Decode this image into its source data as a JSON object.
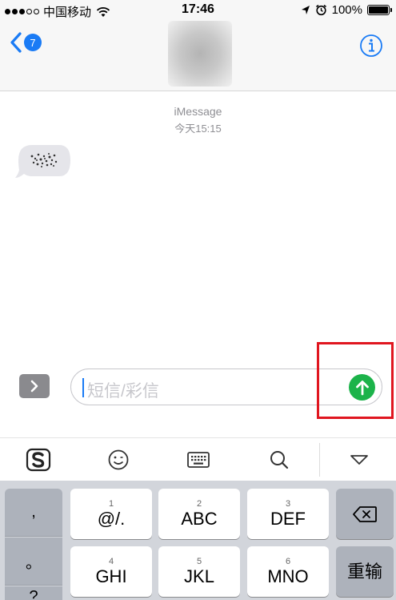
{
  "status_bar": {
    "carrier": "中国移动",
    "time": "17:46",
    "battery": "100%",
    "battery_level": 1.0
  },
  "nav": {
    "unread_count": "7"
  },
  "conversation": {
    "service": "iMessage",
    "timestamp": "今天15:15"
  },
  "composer": {
    "placeholder": "短信/彩信"
  },
  "toolbar": {
    "items": [
      "sogou-logo-icon",
      "emoji-icon",
      "keyboard-icon",
      "search-icon",
      "collapse-icon"
    ]
  },
  "keyboard": {
    "left_keys": [
      ",",
      "。",
      "?"
    ],
    "keys": [
      {
        "num": "1",
        "label": "@/."
      },
      {
        "num": "2",
        "label": "ABC"
      },
      {
        "num": "3",
        "label": "DEF"
      },
      {
        "num": "4",
        "label": "GHI"
      },
      {
        "num": "5",
        "label": "JKL"
      },
      {
        "num": "6",
        "label": "MNO"
      }
    ],
    "enter_label": "重输"
  },
  "colors": {
    "accent": "#1a7bf5",
    "send": "#1cb34a",
    "highlight": "#e0161f"
  }
}
